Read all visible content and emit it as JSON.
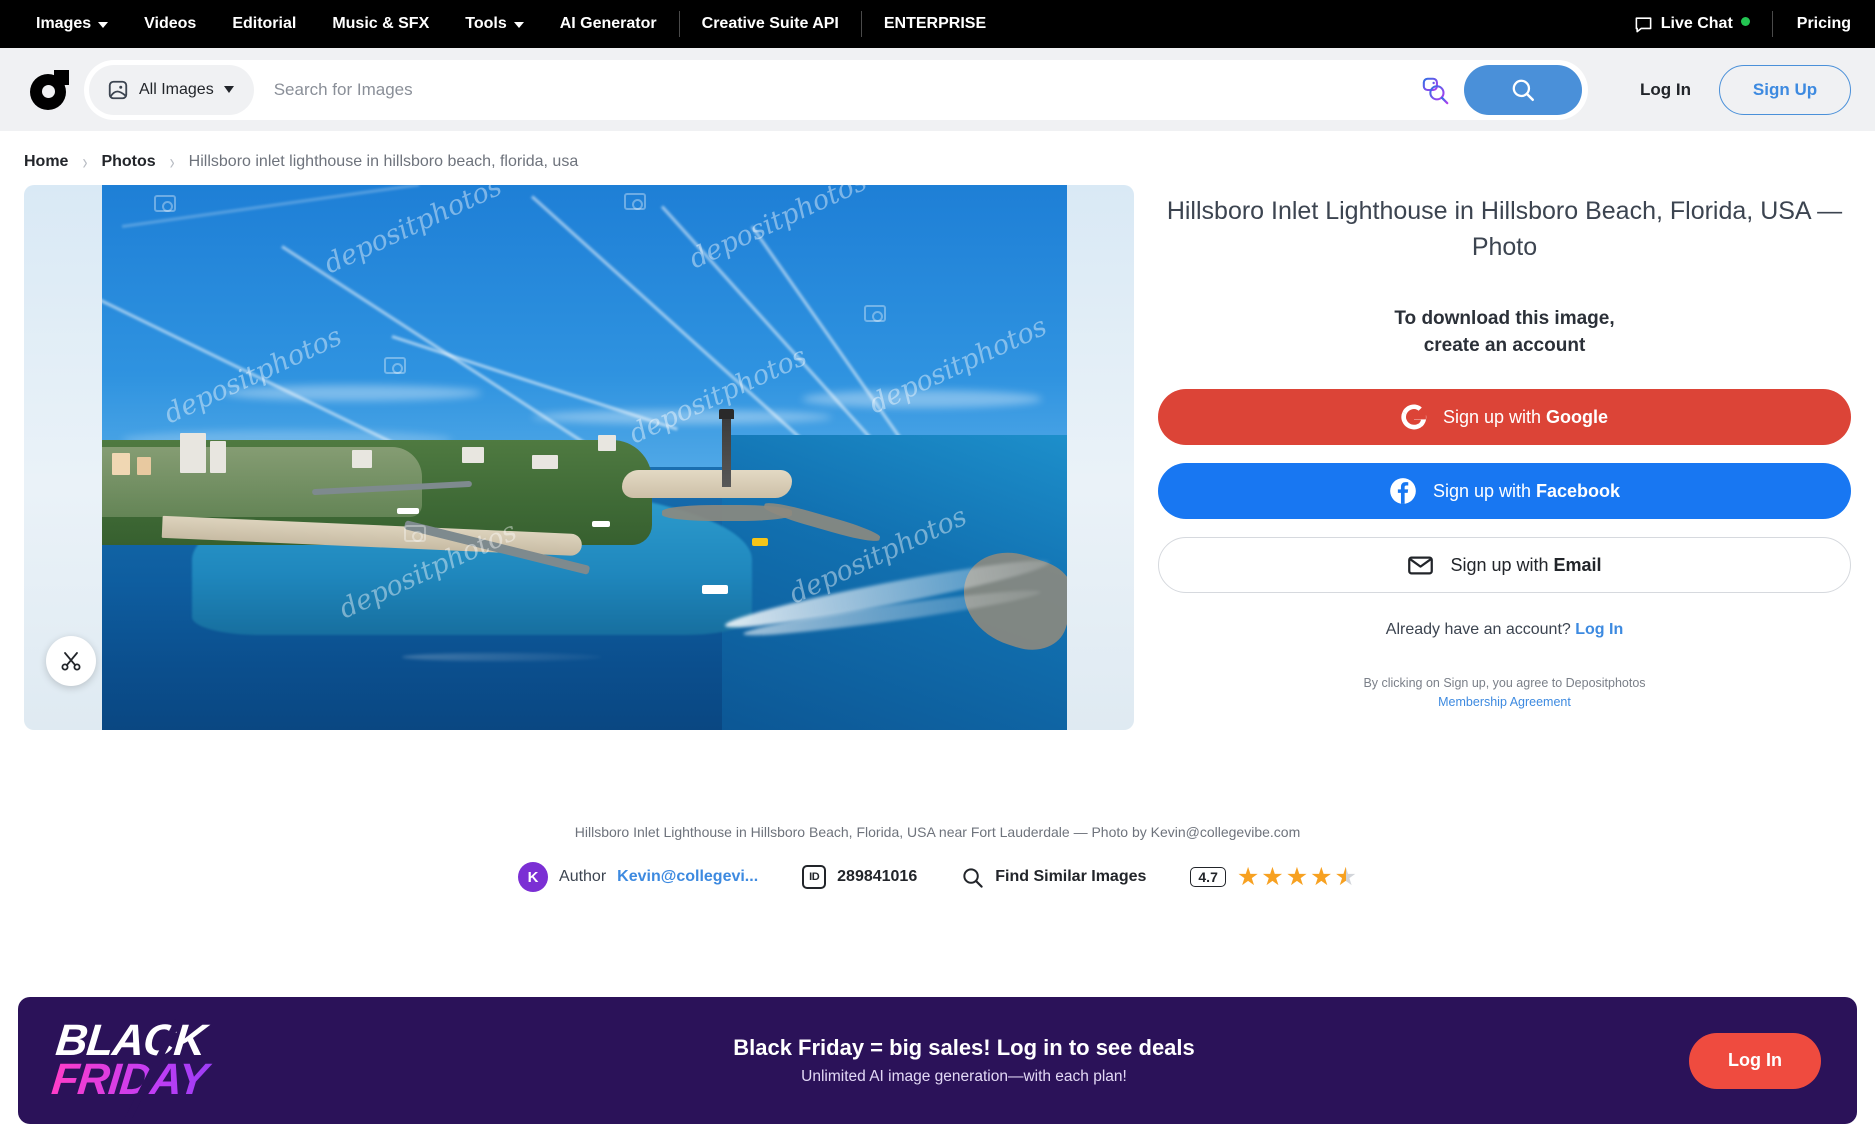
{
  "topnav": {
    "items": [
      {
        "label": "Images",
        "has_caret": true
      },
      {
        "label": "Videos",
        "has_caret": false
      },
      {
        "label": "Editorial",
        "has_caret": false
      },
      {
        "label": "Music & SFX",
        "has_caret": false
      },
      {
        "label": "Tools",
        "has_caret": true
      },
      {
        "label": "AI Generator",
        "has_caret": false
      },
      {
        "label": "Creative Suite API",
        "has_caret": false
      },
      {
        "label": "ENTERPRISE",
        "has_caret": false
      }
    ],
    "live_chat": "Live Chat",
    "pricing": "Pricing",
    "status_color": "#23c552",
    "background": "#000000"
  },
  "header": {
    "category": "All Images",
    "search_placeholder": "Search for Images",
    "search_value": "",
    "login": "Log In",
    "signup": "Sign Up",
    "accent": "#4a90d9"
  },
  "breadcrumb": {
    "home": "Home",
    "photos": "Photos",
    "current": "Hillsboro inlet lighthouse in hillsboro beach, florida, usa",
    "separator": "›"
  },
  "asset": {
    "title": "Hillsboro Inlet Lighthouse in Hillsboro Beach, Florida, USA — Photo",
    "caption": "Hillsboro Inlet Lighthouse in Hillsboro Beach, Florida, USA near Fort Lauderdale — Photo by Kevin@collegevibe.com",
    "watermark_text": "depositphotos"
  },
  "signup_panel": {
    "download_note_line1": "To download this image,",
    "download_note_line2": "create an account",
    "google": {
      "prefix": "Sign up with ",
      "strong": "Google",
      "color": "#dc4437"
    },
    "facebook": {
      "prefix": "Sign up with ",
      "strong": "Facebook",
      "color": "#1877f2"
    },
    "email": {
      "prefix": "Sign up with ",
      "strong": "Email",
      "color": "#ffffff"
    },
    "already_text": "Already have an account?",
    "already_link": "Log In",
    "terms_text": "By clicking on Sign up, you agree to Depositphotos",
    "terms_link": "Membership Agreement"
  },
  "meta": {
    "author_label": "Author",
    "author_name": "Kevin@collegevi...",
    "author_initial": "K",
    "id_badge": "ID",
    "id_value": "289841016",
    "find_similar": "Find Similar Images",
    "rating_value": "4.7",
    "stars_full": 4,
    "stars_half": 1,
    "star_color": "#f7a121"
  },
  "banner": {
    "logo_line1": "BLACK",
    "logo_line2": "FRIDAY",
    "headline": "Black Friday = big sales! Log in to see deals",
    "subline": "Unlimited AI image generation—with each plan!",
    "cta": "Log In",
    "background": "#2b1259",
    "cta_color": "#ef4b3f"
  }
}
